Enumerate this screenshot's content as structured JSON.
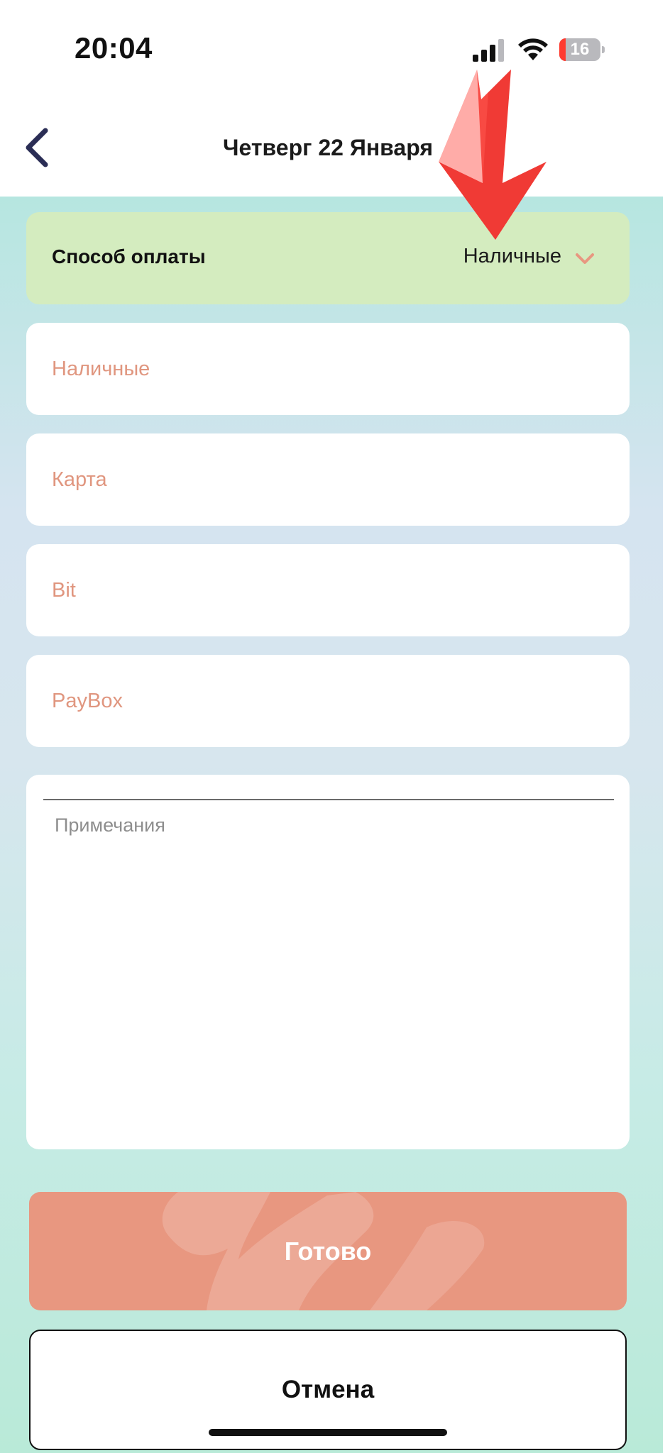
{
  "status_bar": {
    "time": "20:04",
    "battery_level": "16",
    "battery_fraction": 0.16,
    "icons": [
      "signal-icon",
      "wifi-icon",
      "battery-icon"
    ]
  },
  "nav": {
    "back_icon": "chevron-left-icon",
    "title": "Четверг 22 Января"
  },
  "payment_method": {
    "label": "Способ оплаты",
    "selected": "Наличные",
    "icon": "chevron-down-icon"
  },
  "fields": [
    {
      "placeholder": "Наличные",
      "value": ""
    },
    {
      "placeholder": "Карта",
      "value": ""
    },
    {
      "placeholder": "Bit",
      "value": ""
    },
    {
      "placeholder": "PayBox",
      "value": ""
    }
  ],
  "notes": {
    "placeholder": "Примечания",
    "value": ""
  },
  "buttons": {
    "done": "Готово",
    "cancel": "Отмена"
  },
  "colors": {
    "accent": "#e89780",
    "placeholder": "#e0967f",
    "payment_row_bg": "#d4ecbf",
    "annotation_arrow": "#f03a35"
  }
}
